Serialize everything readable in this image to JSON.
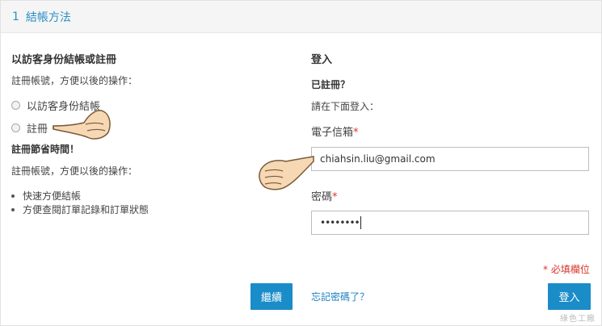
{
  "step": {
    "number": "1",
    "title": "結帳方法"
  },
  "guest": {
    "title": "以訪客身份結帳或註冊",
    "subtitle": "註冊帳號，方便以後的操作：",
    "options": [
      "以訪客身份結帳",
      "註冊"
    ],
    "save_time_title": "註冊節省時間！",
    "save_time_text": "註冊帳號，方便以後的操作：",
    "benefits": [
      "快速方便結帳",
      "方便查閱訂單記錄和訂單狀態"
    ],
    "continue_label": "繼續"
  },
  "login": {
    "title": "登入",
    "registered_title": "已註冊？",
    "instruction": "請在下面登入：",
    "email_label": "電子信箱",
    "email_value": "chiahsin.liu@gmail.com",
    "password_label": "密碼",
    "password_value": "••••••••",
    "required_mark": "*",
    "required_note": "* 必填欄位",
    "forgot_link": "忘記密碼了？",
    "login_button": "登入"
  },
  "watermark": "綠色工廠",
  "colors": {
    "accent": "#1a8cc8",
    "required": "#d9342b",
    "header_text": "#2a8fc7"
  }
}
